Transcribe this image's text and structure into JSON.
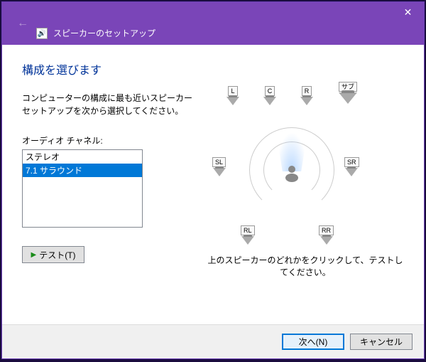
{
  "titlebar": {
    "title": "スピーカーのセットアップ",
    "close": "✕",
    "back": "←"
  },
  "page": {
    "heading": "構成を選びます",
    "description": "コンピューターの構成に最も近いスピーカー セットアップを次から選択してください。",
    "channel_label": "オーディオ チャネル:",
    "options": [
      "ステレオ",
      "7.1 サラウンド"
    ],
    "selected_index": 1,
    "test_button": "テスト(T)",
    "hint": "上のスピーカーのどれかをクリックして、テストしてください。"
  },
  "speakers": {
    "L": "L",
    "C": "C",
    "R": "R",
    "sub": "サブ",
    "SL": "SL",
    "SR": "SR",
    "RL": "RL",
    "RR": "RR"
  },
  "footer": {
    "next": "次へ(N)",
    "cancel": "キャンセル"
  }
}
